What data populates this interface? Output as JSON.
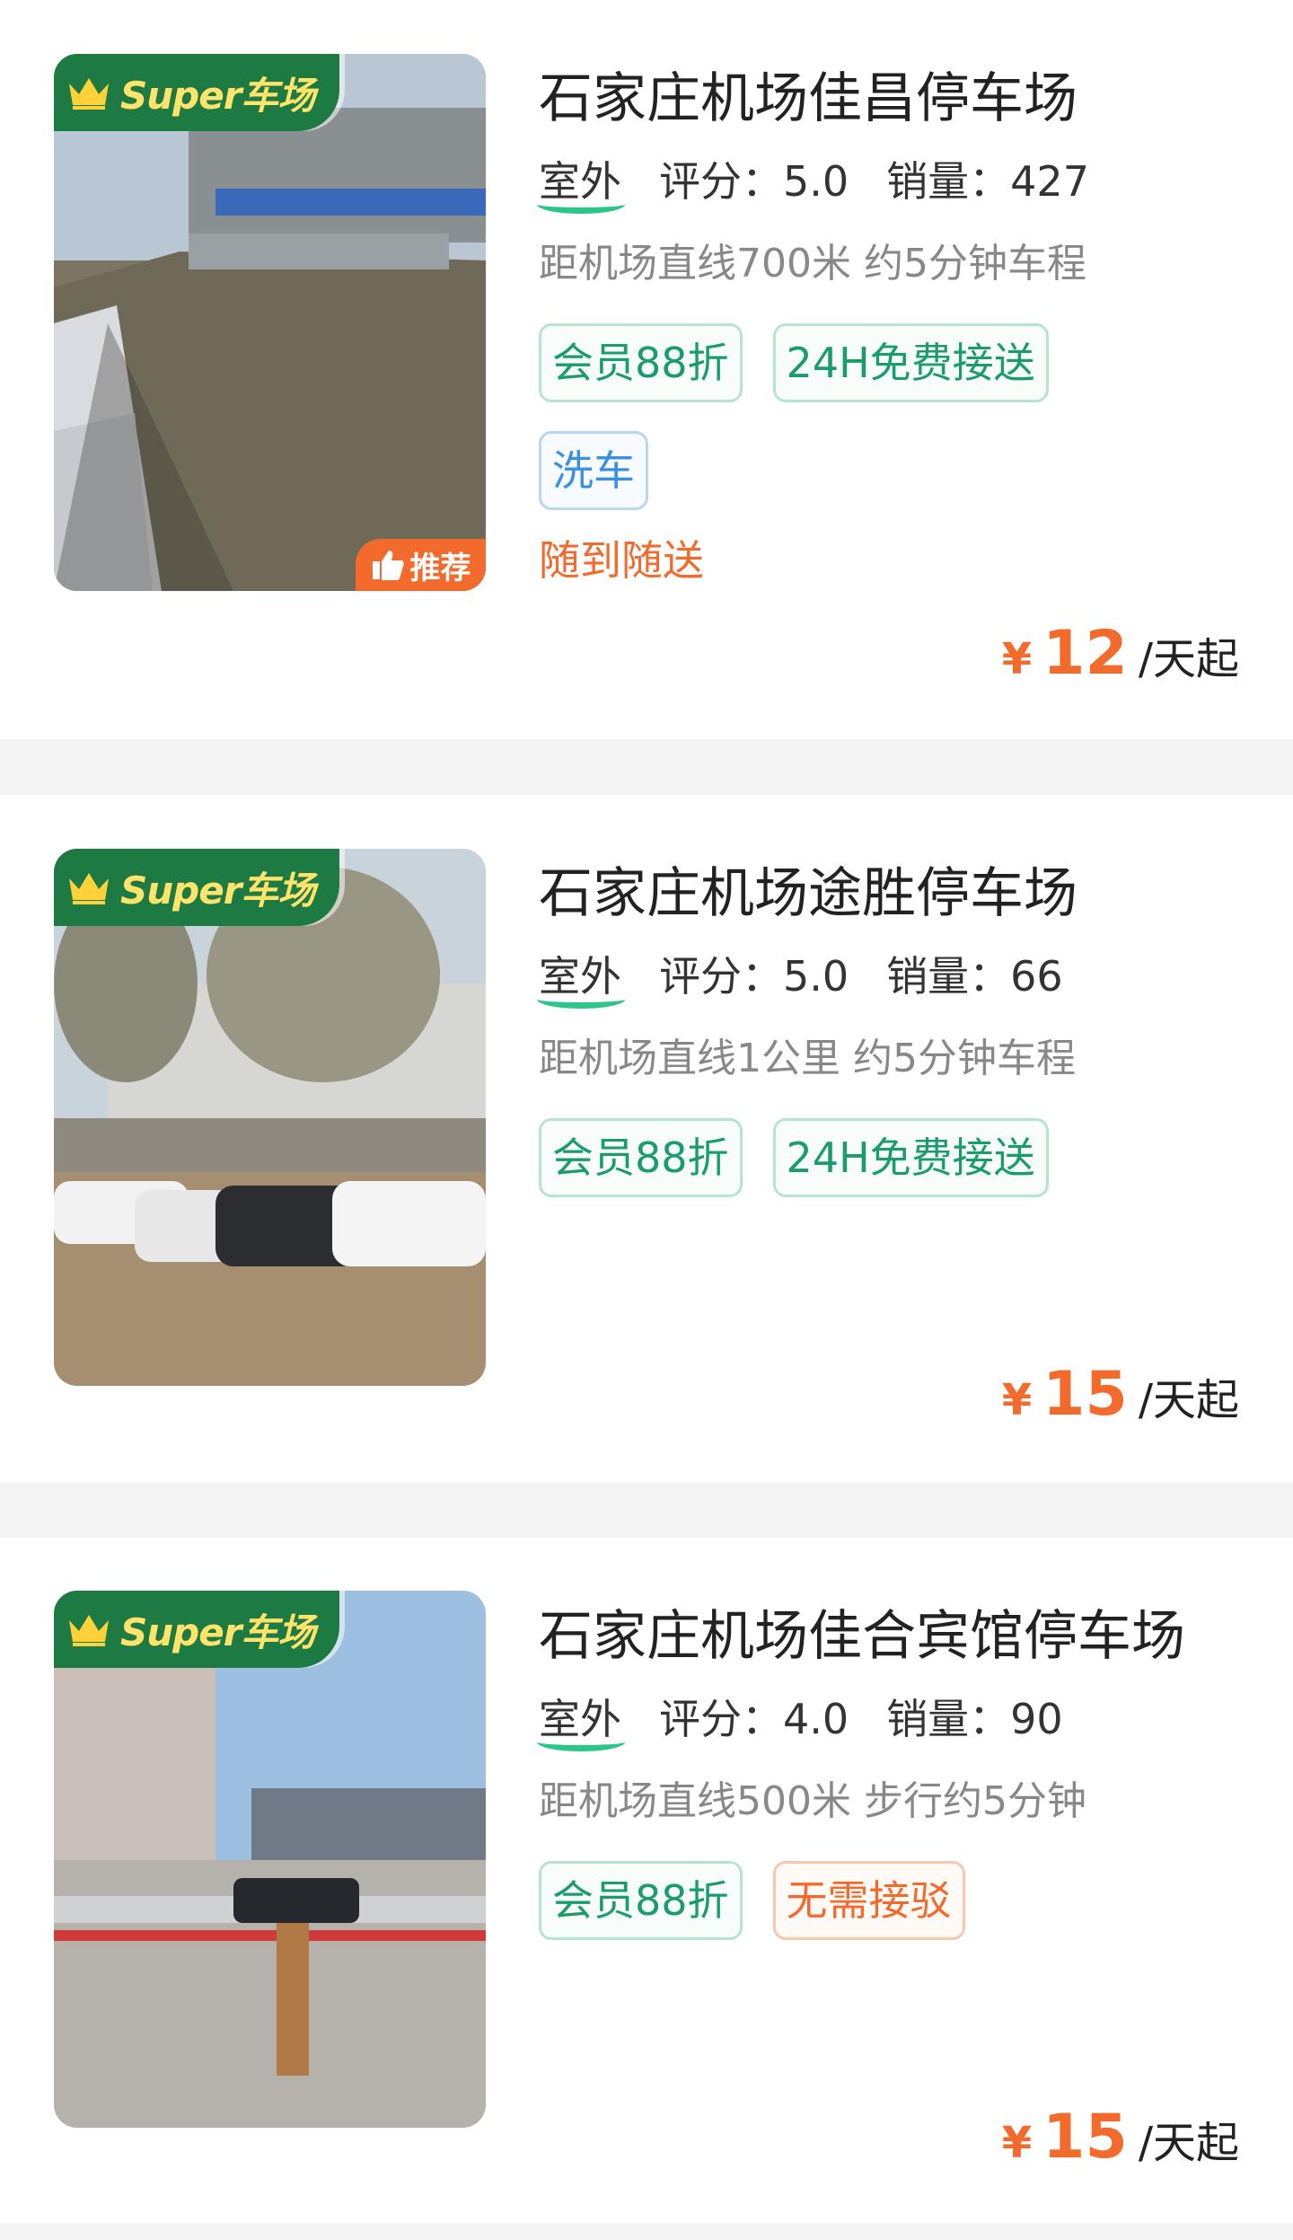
{
  "super_badge": "Super车场",
  "recommend_label": "推荐",
  "lots": [
    {
      "name": "石家庄机场佳昌停车场",
      "location_type": "室外",
      "rating_label": "评分：5.0",
      "sales_label": "销量：427",
      "distance": "距机场直线700米 约5分钟车程",
      "tags": [
        "会员88折",
        "24H免费接送",
        "洗车"
      ],
      "note": "随到随送",
      "price_symbol": "¥",
      "price": "12",
      "price_unit": "/天起",
      "recommended": true
    },
    {
      "name": "石家庄机场途胜停车场",
      "location_type": "室外",
      "rating_label": "评分：5.0",
      "sales_label": "销量：66",
      "distance": "距机场直线1公里 约5分钟车程",
      "tags": [
        "会员88折",
        "24H免费接送"
      ],
      "price_symbol": "¥",
      "price": "15",
      "price_unit": "/天起",
      "recommended": false
    },
    {
      "name": "石家庄机场佳合宾馆停车场",
      "location_type": "室外",
      "rating_label": "评分：4.0",
      "sales_label": "销量：90",
      "distance": "距机场直线500米 步行约5分钟",
      "tags": [
        "会员88折",
        "无需接驳"
      ],
      "price_symbol": "¥",
      "price": "15",
      "price_unit": "/天起",
      "recommended": false
    }
  ],
  "colors": {
    "brand_green": "#1d7a43",
    "badge_text": "#ffe36a",
    "accent_orange": "#f26a2c",
    "tag_green": "#1a9d6b",
    "tag_blue": "#3b8fe0"
  }
}
